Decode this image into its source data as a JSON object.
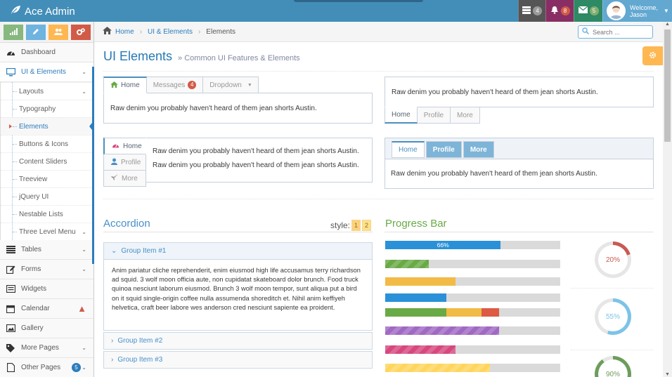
{
  "navbar": {
    "brand": "Ace Admin",
    "tasks_count": "4",
    "notifications_count": "8",
    "messages_count": "5",
    "welcome": "Welcome,",
    "user_name": "Jason"
  },
  "sidebar": {
    "items": [
      {
        "label": "Dashboard"
      },
      {
        "label": "UI & Elements"
      },
      {
        "label": "Tables"
      },
      {
        "label": "Forms"
      },
      {
        "label": "Widgets"
      },
      {
        "label": "Calendar"
      },
      {
        "label": "Gallery"
      },
      {
        "label": "More Pages"
      },
      {
        "label": "Other Pages",
        "badge": "5"
      }
    ],
    "submenu": [
      {
        "label": "Layouts"
      },
      {
        "label": "Typography"
      },
      {
        "label": "Elements"
      },
      {
        "label": "Buttons & Icons"
      },
      {
        "label": "Content Sliders"
      },
      {
        "label": "Treeview"
      },
      {
        "label": "jQuery UI"
      },
      {
        "label": "Nestable Lists"
      },
      {
        "label": "Three Level Menu"
      }
    ]
  },
  "breadcrumb": {
    "home": "Home",
    "parent": "UI & Elements",
    "current": "Elements"
  },
  "search": {
    "placeholder": "Search ..."
  },
  "page": {
    "title": "UI Elements",
    "subtitle": "» Common UI Features & Elements"
  },
  "tabs1": {
    "tabs": [
      "Home",
      "Messages",
      "Dropdown"
    ],
    "messages_badge": "4",
    "content": "Raw denim you probably haven't heard of them jean shorts Austin."
  },
  "tabs2": {
    "tabs": [
      "Home",
      "Profile",
      "More"
    ],
    "content": "Raw denim you probably haven't heard of them jean shorts Austin."
  },
  "tabs3": {
    "tabs": [
      "Home",
      "Profile",
      "More"
    ],
    "content1": "Raw denim you probably haven't heard of them jean shorts Austin.",
    "content2": "Raw denim you probably haven't heard of them jean shorts Austin."
  },
  "tabs4": {
    "tabs": [
      "Home",
      "Profile",
      "More"
    ],
    "content": "Raw denim you probably haven't heard of them jean shorts Austin."
  },
  "accordion": {
    "title": "Accordion",
    "style_label": "style:",
    "styles": [
      "1",
      "2"
    ],
    "items": [
      {
        "label": "Group Item #1"
      },
      {
        "label": "Group Item #2"
      },
      {
        "label": "Group Item #3"
      }
    ],
    "body": "Anim pariatur cliche reprehenderit, enim eiusmod high life accusamus terry richardson ad squid. 3 wolf moon officia aute, non cupidatat skateboard dolor brunch. Food truck quinoa nesciunt laborum eiusmod. Brunch 3 wolf moon tempor, sunt aliqua put a bird on it squid single-origin coffee nulla assumenda shoreditch et. Nihil anim keffiyeh helvetica, craft beer labore wes anderson cred nesciunt sapiente ea proident."
  },
  "progress": {
    "title": "Progress Bar",
    "bars": [
      {
        "segments": [
          {
            "value": 66,
            "color": "#2a91d8"
          }
        ],
        "label": "66%"
      },
      {
        "segments": [
          {
            "value": 25,
            "color": "#69aa46",
            "striped": true
          }
        ]
      },
      {
        "segments": [
          {
            "value": 40,
            "color": "#f2bb46"
          }
        ]
      },
      {
        "segments": [
          {
            "value": 35,
            "color": "#2a91d8"
          }
        ]
      },
      {
        "segments": [
          {
            "value": 35,
            "color": "#69aa46"
          },
          {
            "value": 20,
            "color": "#f2bb46"
          },
          {
            "value": 10,
            "color": "#dd5a43"
          }
        ]
      },
      {
        "segments": [
          {
            "value": 65,
            "color": "#a069c3",
            "striped": true
          }
        ]
      },
      {
        "segments": [
          {
            "value": 40,
            "color": "#d6487e",
            "striped": true
          }
        ]
      },
      {
        "segments": [
          {
            "value": 60,
            "color": "#ffd55d",
            "striped": true
          }
        ]
      }
    ],
    "pies": [
      {
        "percent": 20,
        "label": "20%",
        "color": "#ca5952"
      },
      {
        "percent": 55,
        "label": "55%",
        "color": "#7cc3e8"
      },
      {
        "percent": 90,
        "label": "90%",
        "color": "#6c9d5c"
      }
    ]
  }
}
